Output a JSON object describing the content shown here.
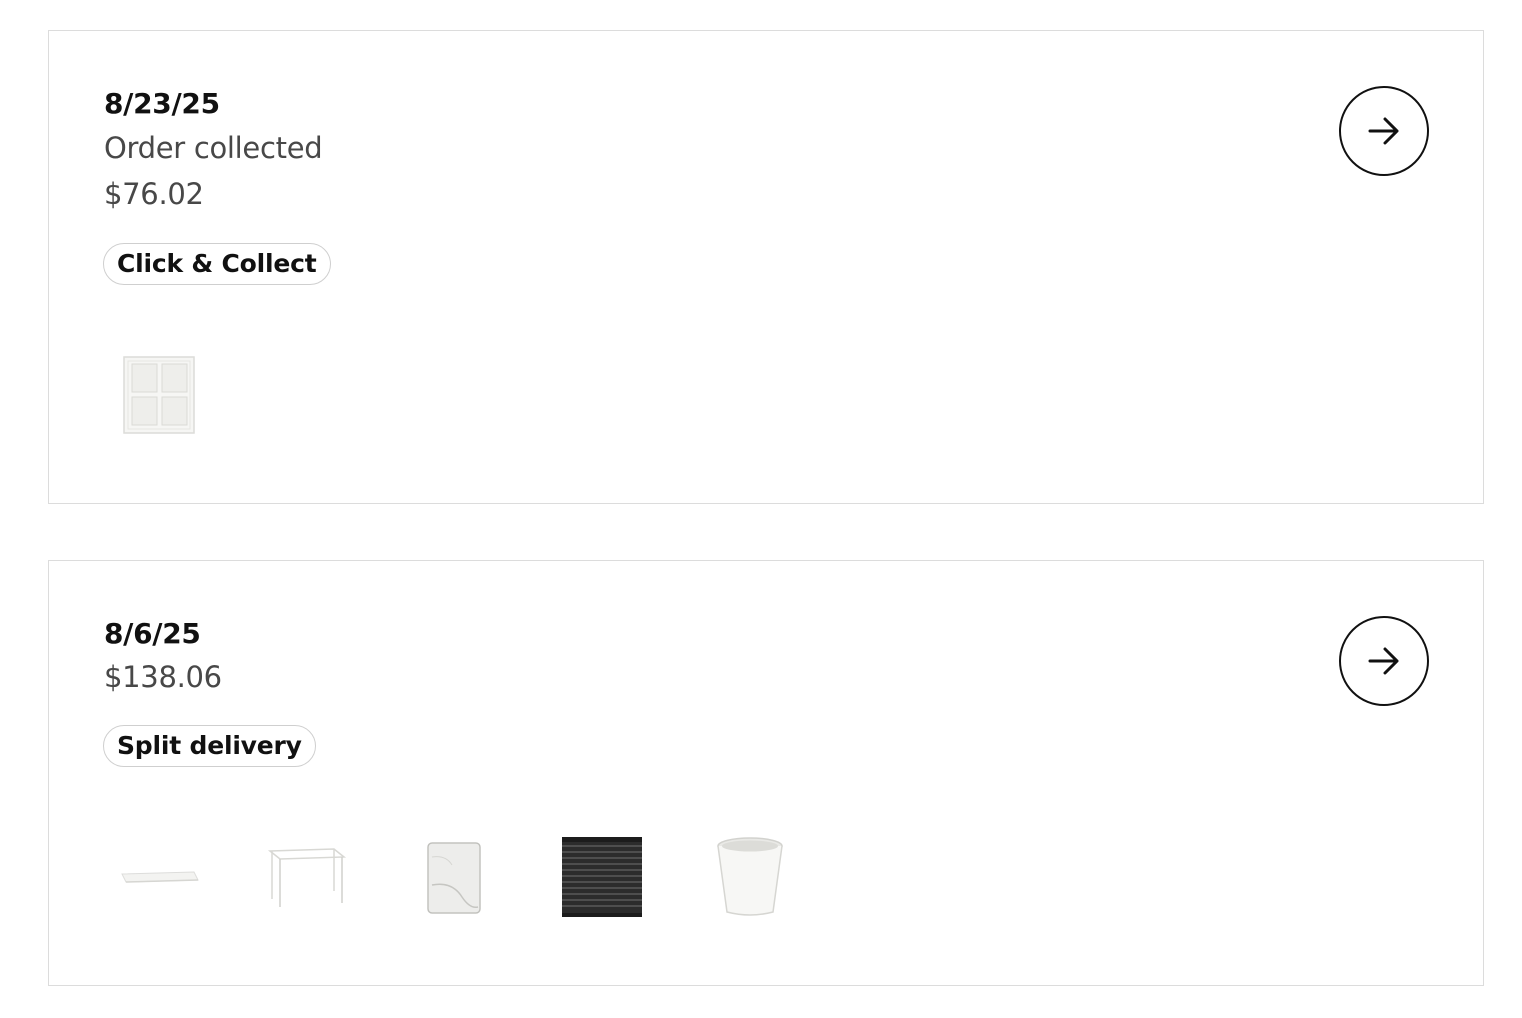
{
  "orders": [
    {
      "date": "8/23/25",
      "status": "Order collected",
      "total": "$76.02",
      "tag": "Click & Collect",
      "items": [
        {
          "icon": "cube-shelf-icon"
        }
      ]
    },
    {
      "date": "8/6/25",
      "total": "$138.06",
      "tag": "Split delivery",
      "items": [
        {
          "icon": "table-top-icon"
        },
        {
          "icon": "table-frame-icon"
        },
        {
          "icon": "fitted-sheet-icon"
        },
        {
          "icon": "pleated-blind-icon"
        },
        {
          "icon": "plant-pot-icon"
        }
      ]
    }
  ],
  "colors": {
    "border": "#dcdcdc",
    "text_primary": "#111111",
    "text_secondary": "#484848",
    "pill_border": "#cfcfcf"
  }
}
